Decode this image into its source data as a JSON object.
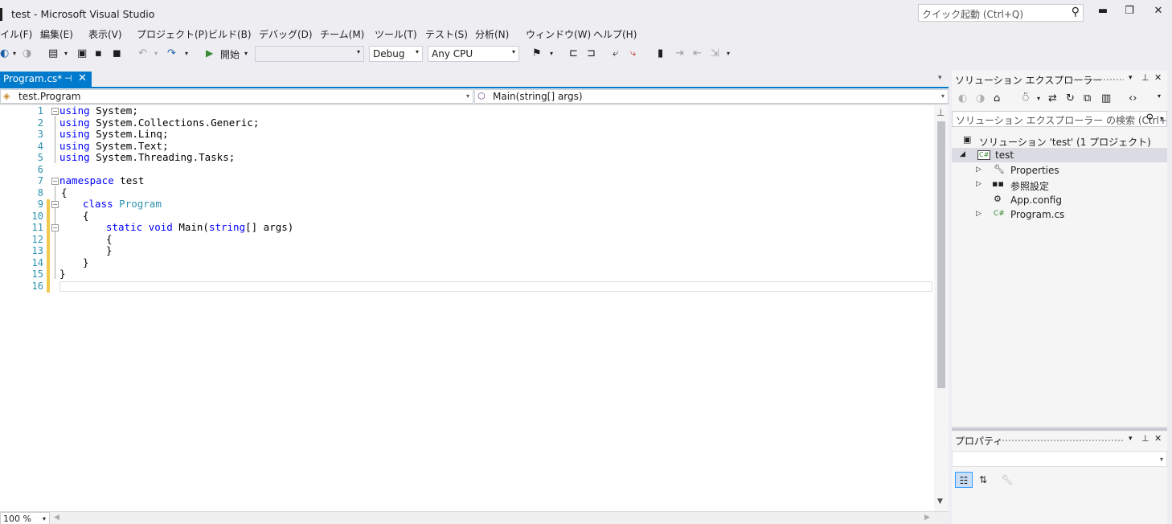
{
  "window": {
    "title": "test - Microsoft Visual Studio",
    "quick_launch_placeholder": "クイック起動 (Ctrl+Q)",
    "minimize": "▬",
    "restore": "❐",
    "close": "✕"
  },
  "menu": [
    "イル(F)",
    "編集(E)",
    "表示(V)",
    "プロジェクト(P)",
    "ビルド(B)",
    "デバッグ(D)",
    "チーム(M)",
    "ツール(T)",
    "テスト(S)",
    "分析(N)",
    "ウィンドウ(W)",
    "ヘルプ(H)"
  ],
  "toolbar": {
    "start_label": "開始",
    "config_value": "Debug",
    "platform_value": "Any CPU"
  },
  "document_tab": {
    "label": "Program.cs*",
    "pin": "⊣",
    "close": "✕"
  },
  "navbar": {
    "left": "test.Program",
    "right": "Main(string[] args)"
  },
  "editor": {
    "line_numbers": [
      "1",
      "2",
      "3",
      "4",
      "5",
      "6",
      "7",
      "8",
      "9",
      "10",
      "11",
      "12",
      "13",
      "14",
      "15",
      "16"
    ],
    "code": {
      "l1_kw": "using",
      "l1_rest": " System;",
      "l2_kw": "using",
      "l2_rest": " System.Collections.Generic;",
      "l3_kw": "using",
      "l3_rest": " System.Linq;",
      "l4_kw": "using",
      "l4_rest": " System.Text;",
      "l5_kw": "using",
      "l5_rest": " System.Threading.Tasks;",
      "l7_kw": "namespace",
      "l7_rest": " test",
      "l8": "{",
      "l9_kw": "class",
      "l9_type": "Program",
      "l10": "{",
      "l11_kw1": "static",
      "l11_kw2": "void",
      "l11_name": " Main(",
      "l11_kw3": "string",
      "l11_rest": "[] args)",
      "l12": "{",
      "l13": "}",
      "l14": "}",
      "l15": "}"
    }
  },
  "zoom": "100 %",
  "solution_explorer": {
    "title": "ソリューション エクスプローラー",
    "search_placeholder": "ソリューション エクスプローラー の検索 (Ctrl+;)",
    "tree": {
      "solution": "ソリューション 'test' (1 プロジェクト)",
      "project": "test",
      "properties": "Properties",
      "references": "参照設定",
      "app_config": "App.config",
      "program_cs": "Program.cs"
    },
    "cs_badge": "C#"
  },
  "properties_panel": {
    "title": "プロパティ"
  },
  "colors": {
    "accent": "#007acc",
    "change_bar": "#f2c94c",
    "keyword": "#0000ff",
    "type": "#2b91af"
  }
}
